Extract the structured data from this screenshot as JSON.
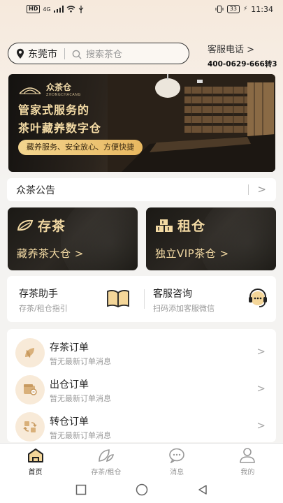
{
  "status_bar": {
    "network_badge": "HD",
    "network_type": "4G",
    "battery": "33",
    "time": "11:34"
  },
  "header": {
    "city": "东莞市",
    "search_placeholder": "搜索茶仓",
    "service_title": "客服电话 >",
    "service_phone": "400-0629-666转3"
  },
  "banner": {
    "logo_text": "众茶仓",
    "logo_sub": "ZHONGCHACANG",
    "headline_1": "管家式服务的",
    "headline_2": "茶叶藏养数字仓",
    "button": "藏养服务、安全放心、方便快捷"
  },
  "notice": {
    "title": "众茶公告",
    "arrow": ">"
  },
  "cards": {
    "store": {
      "title": "存茶",
      "subtitle": "藏养茶大仓 >",
      "icon": "tea-leaf-icon"
    },
    "rent": {
      "title": "租仓",
      "subtitle": "独立VIP茶仓 >",
      "icon": "boxes-icon"
    }
  },
  "helpers": {
    "assistant": {
      "title": "存茶助手",
      "subtitle": "存茶/租仓指引",
      "icon": "book-icon"
    },
    "consult": {
      "title": "客服咨询",
      "subtitle": "扫码添加客服微信",
      "icon": "headset-icon"
    }
  },
  "orders": [
    {
      "title": "存茶订单",
      "subtitle": "暂无最新订单消息",
      "icon": "leaf-order-icon",
      "arrow": ">"
    },
    {
      "title": "出仓订单",
      "subtitle": "暂无最新订单消息",
      "icon": "wallet-icon",
      "arrow": ">"
    },
    {
      "title": "转仓订单",
      "subtitle": "暂无最新订单消息",
      "icon": "transfer-icon",
      "arrow": ">"
    }
  ],
  "tabs": [
    {
      "label": "首页",
      "icon": "home-icon",
      "active": true
    },
    {
      "label": "存茶/租仓",
      "icon": "leaf-icon",
      "active": false
    },
    {
      "label": "消息",
      "icon": "chat-icon",
      "active": false
    },
    {
      "label": "我的",
      "icon": "user-icon",
      "active": false
    }
  ],
  "colors": {
    "accent_gold": "#f2d9a3",
    "card_dark": "#1b1915",
    "order_icon_bg": "#f8ead8"
  }
}
